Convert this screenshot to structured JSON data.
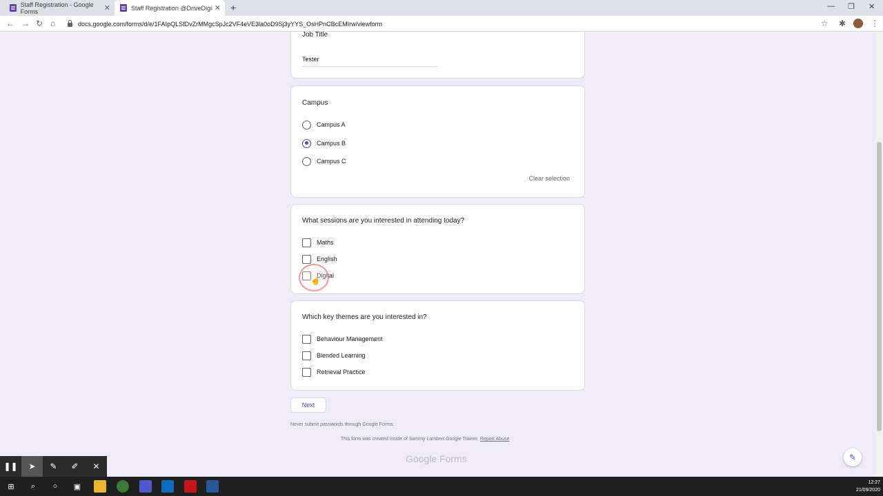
{
  "browser": {
    "tabs": [
      {
        "title": "Staff Registration - Google Forms",
        "active": false
      },
      {
        "title": "Staff Registration @DriveDigiLe",
        "active": true
      }
    ],
    "url": "docs.google.com/forms/d/e/1FAIpQLSfDvZrMMgcSpJc2VF4eVE3la0oD9Sj3yYYS_OsHPnCBcEMIrw/viewform"
  },
  "form": {
    "job_title": {
      "label": "Job Title",
      "value": "Tester"
    },
    "campus": {
      "title": "Campus",
      "options": [
        "Campus A",
        "Campus B",
        "Campus C"
      ],
      "selected": "Campus B",
      "clear_label": "Clear selection"
    },
    "sessions": {
      "title": "What sessions are you interested in attending today?",
      "options": [
        "Maths",
        "English",
        "Digital"
      ]
    },
    "themes": {
      "title": "Which key themes are you interested in?",
      "options": [
        "Behaviour Management",
        "Blended Learning",
        "Retrieval Practice"
      ]
    },
    "next_label": "Next",
    "password_warning": "Never submit passwords through Google Forms.",
    "created_notice": "This form was created inside of Sammy Lambert Google Trainer.",
    "report_abuse": "Report Abuse",
    "logo_text": "Google Forms"
  },
  "taskbar": {
    "time": "12:27",
    "date": "21/09/2020"
  },
  "colors": {
    "accent": "#673ab7",
    "page_bg": "#f0ebf8"
  }
}
